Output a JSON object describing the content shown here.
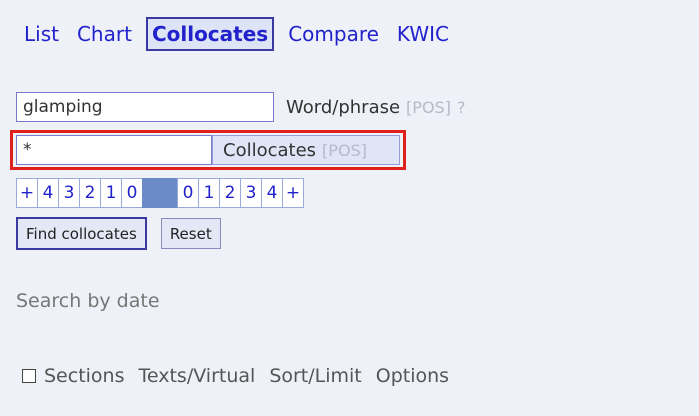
{
  "tabs": [
    {
      "label": "List"
    },
    {
      "label": "Chart"
    },
    {
      "label": "Collocates",
      "active": true
    },
    {
      "label": "Compare"
    },
    {
      "label": "KWIC"
    }
  ],
  "search": {
    "word_value": "glamping",
    "word_label": "Word/phrase",
    "word_pos": "[POS]",
    "word_help": "?",
    "collocate_value": "*",
    "collocate_label": "Collocates",
    "collocate_pos": "[POS]"
  },
  "window": {
    "left": [
      "+",
      "4",
      "3",
      "2",
      "1",
      "0"
    ],
    "right": [
      "0",
      "1",
      "2",
      "3",
      "4",
      "+"
    ]
  },
  "buttons": {
    "find": "Find collocates",
    "reset": "Reset"
  },
  "date_label": "Search by date",
  "options": {
    "sections": "Sections",
    "texts": "Texts/Virtual",
    "sort": "Sort/Limit",
    "options": "Options"
  },
  "colors": {
    "link": "#2222cc",
    "highlight": "#e0201a",
    "node": "#6a8bc8",
    "background": "#eef1f8"
  }
}
